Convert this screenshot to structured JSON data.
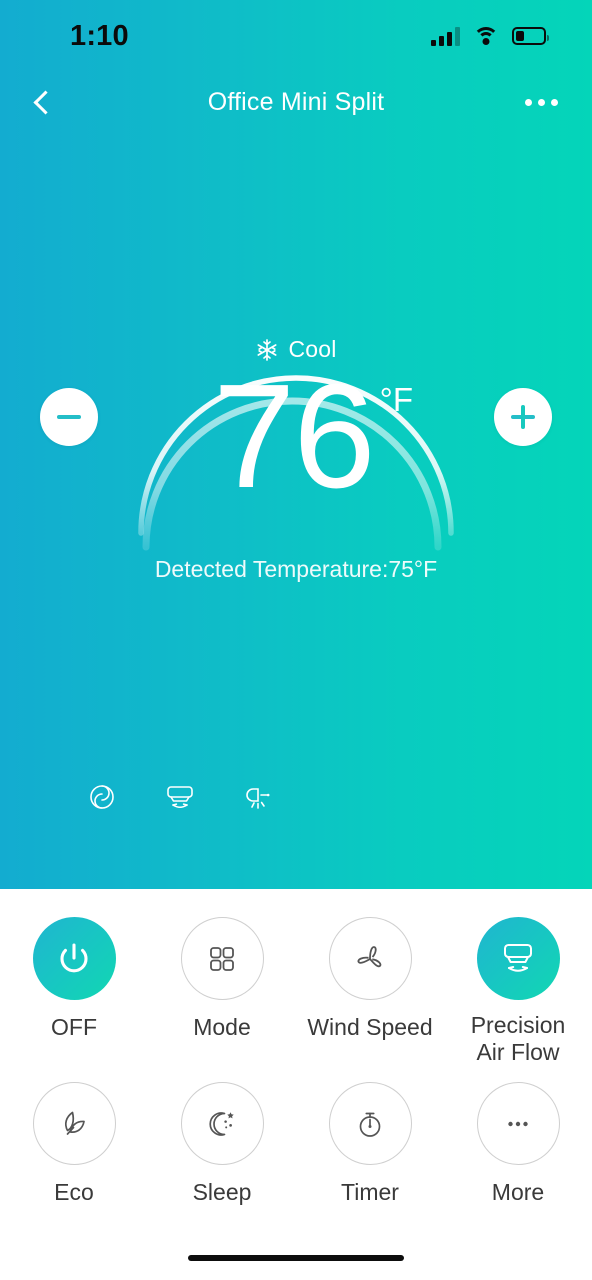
{
  "status_bar": {
    "time": "1:10",
    "signal_icon": "cellular-signal-icon",
    "wifi_icon": "wifi-icon",
    "battery_icon": "battery-low-icon",
    "battery_level_percent": 26
  },
  "nav": {
    "back_icon": "chevron-left-icon",
    "title": "Office Mini Split",
    "more_icon": "more-horizontal-icon"
  },
  "thermostat": {
    "mode_icon": "snowflake-icon",
    "mode_label": "Cool",
    "target_temperature": "76",
    "unit": "°F",
    "detected_text": "Detected Temperature:75°F",
    "decrease_icon": "minus-icon",
    "increase_icon": "plus-icon",
    "dial_arc_color": "#ffffff"
  },
  "status_icons": [
    {
      "name": "swirl-fan-icon",
      "label": "Auto Fan"
    },
    {
      "name": "air-flow-swing-icon",
      "label": "Precision Air Flow"
    },
    {
      "name": "light-sensor-icon",
      "label": "Display Light"
    }
  ],
  "controls": {
    "row1": [
      {
        "label": "OFF",
        "icon": "power-icon",
        "active": true
      },
      {
        "label": "Mode",
        "icon": "grid-squares-icon",
        "active": false
      },
      {
        "label": "Wind Speed",
        "icon": "fan-blades-icon",
        "active": false
      },
      {
        "label": "Precision\nAir Flow",
        "label_line1": "Precision",
        "label_line2": "Air Flow",
        "icon": "air-conditioner-swing-icon",
        "active": true
      }
    ],
    "row2": [
      {
        "label": "Eco",
        "icon": "leaf-icon",
        "active": false
      },
      {
        "label": "Sleep",
        "icon": "moon-stars-icon",
        "active": false
      },
      {
        "label": "Timer",
        "icon": "stopwatch-icon",
        "active": false
      },
      {
        "label": "More",
        "icon": "more-dots-icon",
        "active": false
      }
    ]
  },
  "theme": {
    "gradient_start": "#13ACD0",
    "gradient_end": "#04D5B9",
    "active_button_start": "#20B5D0",
    "active_button_end": "#12D7B2",
    "panel_background": "#ffffff",
    "label_color": "#3a3a3a",
    "inactive_outline": "#cfcfcf"
  },
  "home_indicator": "home-indicator"
}
